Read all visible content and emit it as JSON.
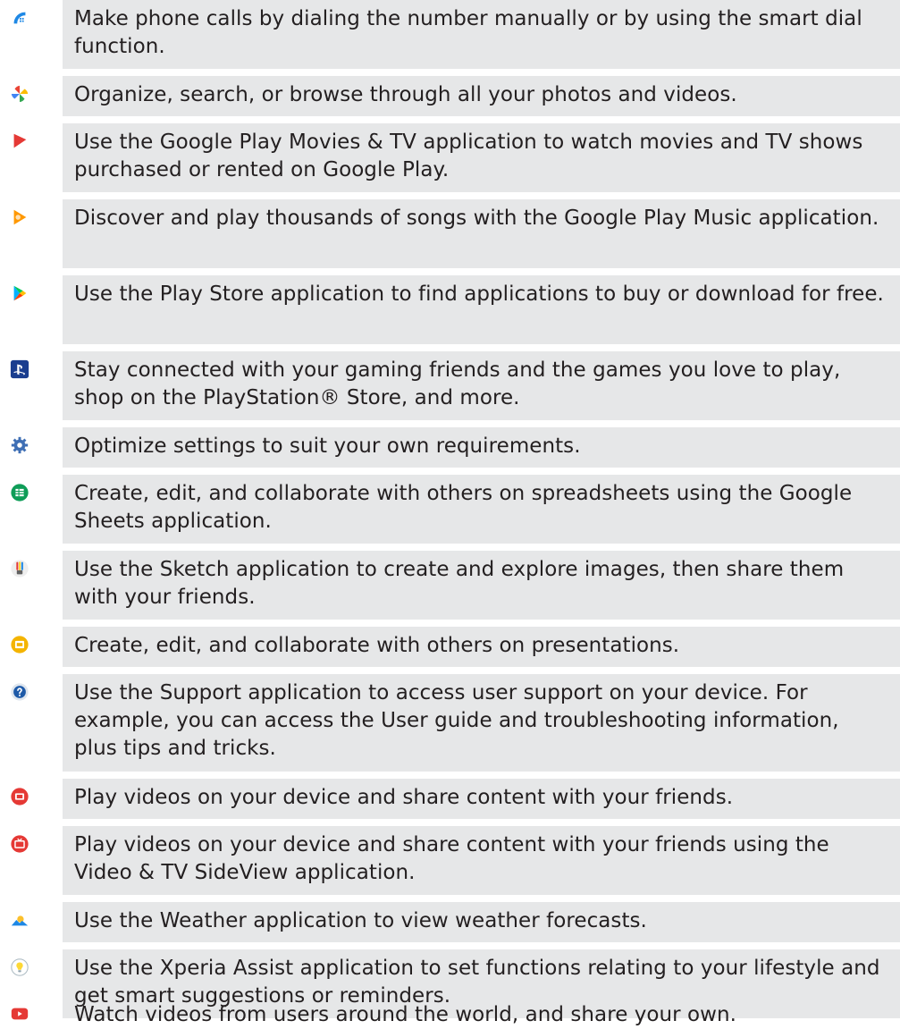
{
  "rows": [
    {
      "icon": "phone-dialer-icon",
      "text": "Make phone calls by dialing the number manually or by using the smart dial function."
    },
    {
      "icon": "google-photos-icon",
      "text": "Organize, search, or browse through all your photos and videos."
    },
    {
      "icon": "play-movies-icon",
      "text": "Use the Google Play Movies & TV application to watch movies and TV shows purchased or rented on Google Play."
    },
    {
      "icon": "play-music-icon",
      "text": "Discover and play thousands of songs with the Google Play Music application."
    },
    {
      "icon": "play-store-icon",
      "text": "Use the Play Store application to find applications to buy or download for free."
    },
    {
      "icon": "playstation-icon",
      "text": "Stay connected with your gaming friends and the games you love to play, shop on the PlayStation® Store, and more."
    },
    {
      "icon": "settings-gear-icon",
      "text": "Optimize settings to suit your own requirements."
    },
    {
      "icon": "google-sheets-icon",
      "text": "Create, edit, and collaborate with others on spreadsheets using the Google Sheets application."
    },
    {
      "icon": "sketch-icon",
      "text": "Use the Sketch application to create and explore images, then share them with your friends."
    },
    {
      "icon": "google-slides-icon",
      "text": "Create, edit, and collaborate with others on presentations."
    },
    {
      "icon": "support-icon",
      "text": "Use the Support application to access user support on your device. For example, you can access the User guide and troubleshooting information, plus tips and tricks."
    },
    {
      "icon": "video-icon",
      "text": "Play videos on your device and share content with your friends."
    },
    {
      "icon": "video-tv-sideview-icon",
      "text": "Play videos on your device and share content with your friends using the Video & TV SideView application."
    },
    {
      "icon": "weather-icon",
      "text": "Use the Weather application to view weather forecasts."
    },
    {
      "icon": "xperia-assist-icon",
      "text": "Use the Xperia Assist application to set functions relating to your lifestyle and get smart suggestions or reminders."
    },
    {
      "icon": "youtube-icon",
      "text": "Watch videos from users around the world, and share your own."
    }
  ]
}
